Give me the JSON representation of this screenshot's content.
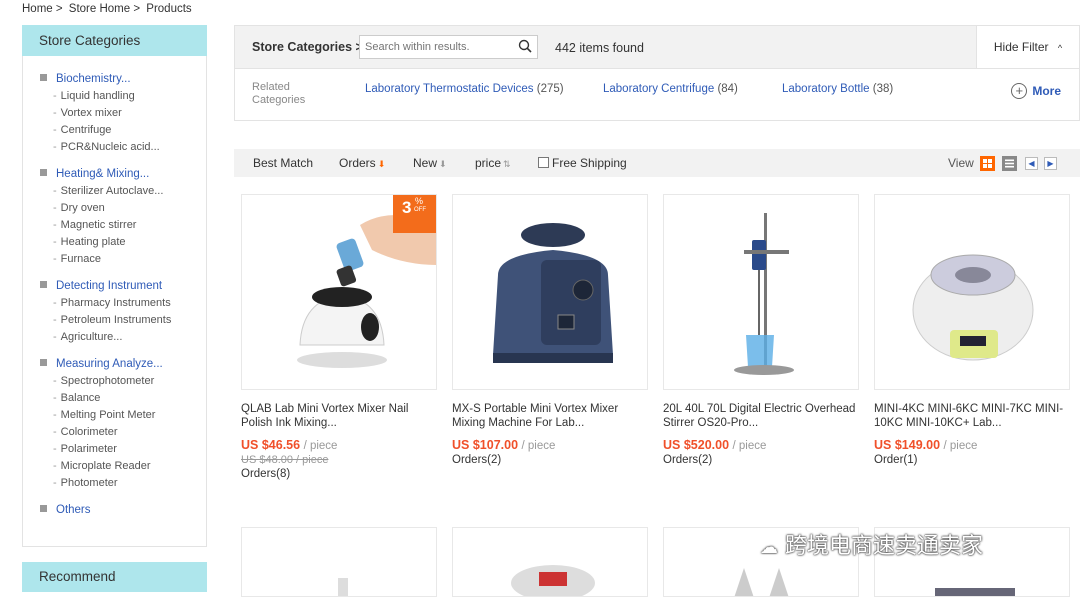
{
  "breadcrumb": {
    "home": "Home >",
    "store_home": "Store Home >",
    "products": "Products"
  },
  "sidebar": {
    "title": "Store Categories",
    "groups": [
      {
        "label": "Biochemistry...",
        "subs": [
          "Liquid handling",
          "Vortex mixer",
          "Centrifuge",
          "PCR&Nucleic acid..."
        ]
      },
      {
        "label": "Heating& Mixing...",
        "subs": [
          "Sterilizer Autoclave...",
          "Dry oven",
          "Magnetic stirrer",
          "Heating plate",
          "Furnace"
        ]
      },
      {
        "label": "Detecting Instrument",
        "subs": [
          "Pharmacy Instruments",
          "Petroleum Instruments",
          "Agriculture..."
        ]
      },
      {
        "label": "Measuring Analyze...",
        "subs": [
          "Spectrophotometer",
          "Balance",
          "Melting Point Meter",
          "Colorimeter",
          "Polarimeter",
          "Microplate Reader",
          "Photometer"
        ]
      },
      {
        "label": "Others",
        "subs": []
      }
    ],
    "recommend": "Recommend"
  },
  "topbar": {
    "store_categories": "Store Categories >",
    "search_placeholder": "Search within results.",
    "items_found": "442 items found",
    "hide_filter": "Hide Filter"
  },
  "related": {
    "label": "Related Categories",
    "links": [
      {
        "name": "Laboratory Thermostatic Devices",
        "count": "(275)"
      },
      {
        "name": "Laboratory Centrifuge",
        "count": "(84)"
      },
      {
        "name": "Laboratory Bottle",
        "count": "(38)"
      }
    ],
    "more": "More"
  },
  "sortbar": {
    "best_match": "Best Match",
    "orders": "Orders",
    "new": "New",
    "price": "price",
    "free_shipping": "Free Shipping",
    "view": "View"
  },
  "products": [
    {
      "title": "QLAB Lab Mini Vortex Mixer Nail Polish Ink Mixing...",
      "price": "US $46.56",
      "unit": "/ piece",
      "old_price": "US $48.00 / piece",
      "orders": "Orders(8)",
      "badge_num": "3",
      "badge_pct": "%",
      "badge_off": "OFF"
    },
    {
      "title": "MX-S Portable Mini Vortex Mixer Mixing Machine For Lab...",
      "price": "US $107.00",
      "unit": "/ piece",
      "orders": "Orders(2)"
    },
    {
      "title": "20L 40L 70L Digital Electric Overhead Stirrer OS20-Pro...",
      "price": "US $520.00",
      "unit": "/ piece",
      "orders": "Orders(2)"
    },
    {
      "title": "MINI-4KC MINI-6KC MINI-7KC MINI-10KC MINI-10KC+ Lab...",
      "price": "US $149.00",
      "unit": "/ piece",
      "orders": "Order(1)"
    }
  ],
  "watermark": "跨境电商速卖通卖家",
  "colors": {
    "accent": "#f60",
    "link": "#2f5bb7",
    "sidebar_head": "#aee6ec",
    "price": "#f0502a"
  }
}
